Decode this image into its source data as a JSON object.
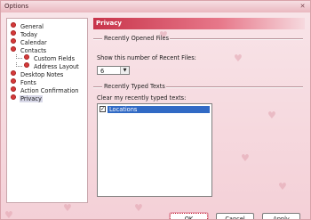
{
  "window": {
    "title": "Options",
    "close_glyph": "✕"
  },
  "tree": {
    "items": [
      {
        "label": "General",
        "level": 0,
        "icon": "bullet-icon"
      },
      {
        "label": "Today",
        "level": 0,
        "icon": "bullet-icon"
      },
      {
        "label": "Calendar",
        "level": 0,
        "icon": "bullet-icon"
      },
      {
        "label": "Contacts",
        "level": 0,
        "icon": "bullet-icon"
      },
      {
        "label": "Custom Fields",
        "level": 1,
        "icon": "bullet-icon"
      },
      {
        "label": "Address Layout",
        "level": 1,
        "icon": "bullet-icon"
      },
      {
        "label": "Desktop Notes",
        "level": 0,
        "icon": "bullet-icon"
      },
      {
        "label": "Fonts",
        "level": 0,
        "icon": "bullet-icon"
      },
      {
        "label": "Action Confirmation",
        "level": 0,
        "icon": "bullet-icon"
      },
      {
        "label": "Privacy",
        "level": 0,
        "icon": "bullet-icon",
        "selected": true
      }
    ]
  },
  "panel": {
    "title": "Privacy",
    "recent_files": {
      "group_title": "Recently Opened Files",
      "label": "Show this number of Recent Files:",
      "value": "6",
      "dropdown_arrow": "▼"
    },
    "recent_texts": {
      "group_title": "Recently Typed Texts",
      "label": "Clear my recently typed texts:",
      "items": [
        {
          "label": "Locations",
          "checked": true,
          "check_glyph": "✓"
        }
      ]
    }
  },
  "buttons": {
    "ok": "OK",
    "cancel": "Cancel",
    "apply": "Apply"
  },
  "colors": {
    "accent": "#c8344a",
    "selection": "#316ac5",
    "bullet": "#d53a3a"
  }
}
